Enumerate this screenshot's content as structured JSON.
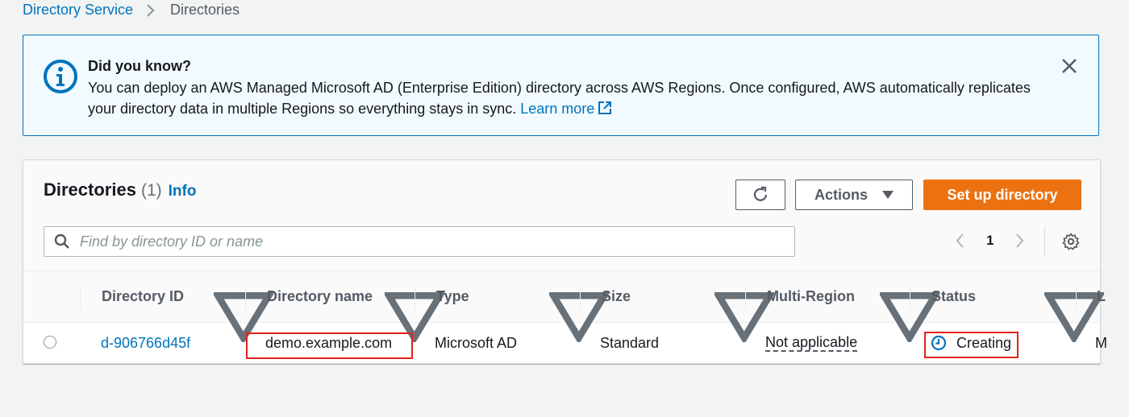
{
  "breadcrumb": {
    "root": "Directory Service",
    "current": "Directories"
  },
  "flash": {
    "title": "Did you know?",
    "body_line1": "You can deploy an AWS Managed Microsoft AD (Enterprise Edition) directory across AWS Regions. Once configured, AWS automatically replicates",
    "body_line2": "your directory data in multiple Regions so everything stays in sync.",
    "learn_more": "Learn more",
    "icon": "info-circle-icon"
  },
  "panel": {
    "title": "Directories",
    "count": "(1)",
    "info": "Info",
    "refresh_icon": "refresh-icon",
    "actions_label": "Actions",
    "primary_label": "Set up directory",
    "search_placeholder": "Find by directory ID or name",
    "page": "1"
  },
  "table": {
    "columns": [
      "Directory ID",
      "Directory name",
      "Type",
      "Size",
      "Multi-Region",
      "Status",
      "L"
    ],
    "rows": [
      {
        "id": "d-906766d45f",
        "name": "demo.example.com",
        "type": "Microsoft AD",
        "size": "Standard",
        "multi_region": "Not applicable",
        "status": "Creating",
        "last": "M"
      }
    ]
  },
  "colors": {
    "accent": "#0073bb",
    "primary": "#ec7211",
    "highlight": "#e0231c",
    "flash_bg": "#f1faff"
  }
}
